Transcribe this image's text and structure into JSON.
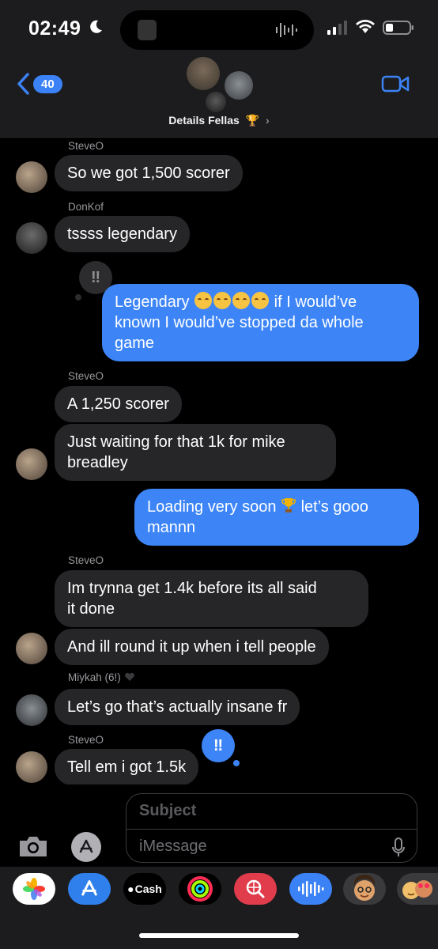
{
  "status_bar": {
    "time": "02:49"
  },
  "header": {
    "back_badge": "40",
    "group_name": "Details Fellas",
    "title_emoji": "🏆",
    "chevron": "›"
  },
  "messages": [
    {
      "type": "sender",
      "text": "SteveO"
    },
    {
      "type": "incoming",
      "text": "So we got 1,500 scorer"
    },
    {
      "type": "sender",
      "text": "DonKof"
    },
    {
      "type": "incoming",
      "text": "tssss legendary"
    },
    {
      "type": "outgoing",
      "line1_pre": "Legendary",
      "line1_post": "if I would’ve",
      "line2": "known I would’ve stopped da whole",
      "line3": "game",
      "tapback": "‼"
    },
    {
      "type": "sender",
      "text": "SteveO"
    },
    {
      "type": "incoming",
      "text": "A 1,250 scorer"
    },
    {
      "type": "incoming",
      "line1": "Just waiting for that 1k for mike",
      "line2": "breadley"
    },
    {
      "type": "outgoing",
      "line1_pre": "Loading very soon",
      "line1_post": "let’s gooo",
      "line2": "mannn"
    },
    {
      "type": "sender",
      "text": "SteveO"
    },
    {
      "type": "incoming",
      "line1": "Im trynna get 1.4k before its all said",
      "line2": "it done"
    },
    {
      "type": "incoming",
      "text": "And ill round it up when i tell people"
    },
    {
      "type": "sender",
      "text": "Miykah (6!)"
    },
    {
      "type": "incoming",
      "text": "Let’s go that’s actually insane fr"
    },
    {
      "type": "sender",
      "text": "SteveO"
    },
    {
      "type": "incoming",
      "text": "Tell em i got 1.5k",
      "tapback": "‼"
    }
  ],
  "compose": {
    "subject_placeholder": "Subject",
    "message_placeholder": "iMessage"
  },
  "app_drawer": [
    {
      "name": "photos-app",
      "label": ""
    },
    {
      "name": "app-store-app",
      "label": ""
    },
    {
      "name": "apple-cash-app",
      "label": "Cash"
    },
    {
      "name": "fitness-app",
      "label": ""
    },
    {
      "name": "search-images-app",
      "label": ""
    },
    {
      "name": "audio-message-app",
      "label": ""
    },
    {
      "name": "memoji-app",
      "label": ""
    },
    {
      "name": "memoji-stickers-app",
      "label": ""
    }
  ],
  "colors": {
    "outgoing_bubble": "#3d85f7",
    "incoming_bubble": "#262628",
    "accent": "#3b82f6",
    "background": "#000000"
  }
}
